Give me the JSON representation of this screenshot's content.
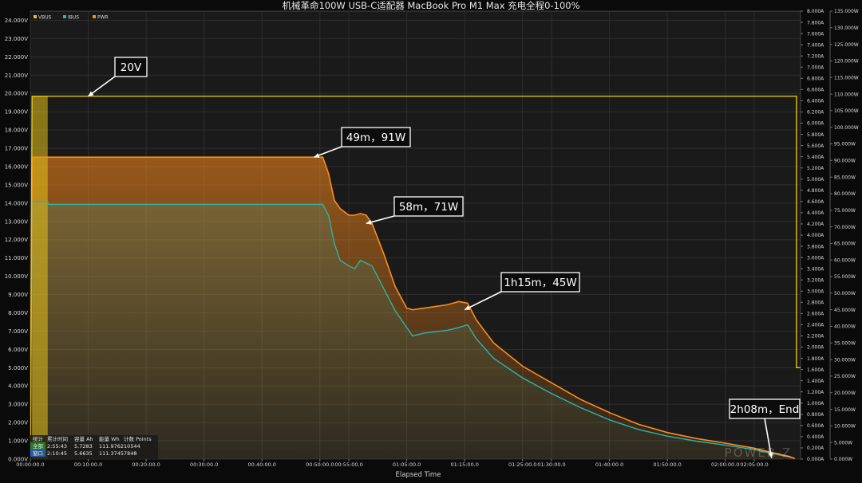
{
  "chart_data": {
    "type": "line",
    "title": "机械革命100W USB-C适配器 MacBook Pro M1 Max 充电全程0-100%",
    "xlabel": "Elapsed Time",
    "x_unit": "minutes",
    "xlim": [
      0,
      133
    ],
    "x_ticks": [
      {
        "t": 0,
        "label": "00:00:00.0"
      },
      {
        "t": 10,
        "label": "00:10:00.0"
      },
      {
        "t": 20,
        "label": "00:20:00.0"
      },
      {
        "t": 30,
        "label": "00:30:00.0"
      },
      {
        "t": 40,
        "label": "00:40:00.0"
      },
      {
        "t": 50,
        "label": "00:50:00.0"
      },
      {
        "t": 55,
        "label": "00:55:00.0"
      },
      {
        "t": 65,
        "label": "01:05:00.0"
      },
      {
        "t": 75,
        "label": "01:15:00.0"
      },
      {
        "t": 85,
        "label": "01:25:00.0"
      },
      {
        "t": 90,
        "label": "01:30:00.0"
      },
      {
        "t": 100,
        "label": "01:40:00.0"
      },
      {
        "t": 110,
        "label": "01:50:00.0"
      },
      {
        "t": 120,
        "label": "02:00:00.0"
      },
      {
        "t": 125,
        "label": "02:05:00.0"
      }
    ],
    "y_left": {
      "unit": "V",
      "min": 0,
      "max": 24.5,
      "step": 1,
      "decimals": 3
    },
    "y_right_current": {
      "unit": "A",
      "min": 0,
      "max": 8.0,
      "step": 0.2,
      "decimals": 3
    },
    "y_right_power": {
      "unit": "W",
      "min": 0,
      "max": 135,
      "step": 5,
      "decimals": 3
    },
    "grid": true,
    "legend_position": "top-left",
    "series": [
      {
        "name": "VBUS",
        "axis": "voltage",
        "color": "#e6c21a",
        "points": [
          [
            0,
            0
          ],
          [
            0.3,
            19.85
          ],
          [
            132.3,
            19.85
          ],
          [
            132.3,
            5.0
          ],
          [
            133,
            5.0
          ]
        ]
      },
      {
        "name": "IBUS",
        "axis": "current",
        "color": "#2ab5a8",
        "points": [
          [
            0,
            0
          ],
          [
            0.3,
            4.6
          ],
          [
            3.0,
            4.6
          ],
          [
            3.0,
            4.55
          ],
          [
            50.5,
            4.55
          ],
          [
            51.5,
            4.35
          ],
          [
            52.5,
            3.85
          ],
          [
            53.5,
            3.55
          ],
          [
            55,
            3.45
          ],
          [
            56,
            3.4
          ],
          [
            57,
            3.55
          ],
          [
            58,
            3.5
          ],
          [
            59,
            3.45
          ],
          [
            61,
            3.05
          ],
          [
            63,
            2.65
          ],
          [
            65,
            2.35
          ],
          [
            66,
            2.2
          ],
          [
            68,
            2.25
          ],
          [
            72,
            2.3
          ],
          [
            74,
            2.35
          ],
          [
            75.5,
            2.4
          ],
          [
            77,
            2.15
          ],
          [
            80,
            1.8
          ],
          [
            85,
            1.45
          ],
          [
            90,
            1.17
          ],
          [
            95,
            0.92
          ],
          [
            100,
            0.7
          ],
          [
            105,
            0.53
          ],
          [
            110,
            0.41
          ],
          [
            115,
            0.32
          ],
          [
            120,
            0.25
          ],
          [
            125,
            0.17
          ],
          [
            128,
            0.1
          ],
          [
            131,
            0.04
          ],
          [
            132,
            0.01
          ]
        ]
      },
      {
        "name": "PWR",
        "axis": "power",
        "color": "#ff8c1a",
        "points": [
          [
            0,
            0
          ],
          [
            0.3,
            91
          ],
          [
            3.0,
            91
          ],
          [
            50.5,
            91
          ],
          [
            51.5,
            86
          ],
          [
            52.5,
            78
          ],
          [
            53.5,
            75.5
          ],
          [
            55,
            73.5
          ],
          [
            56,
            73.5
          ],
          [
            57,
            74
          ],
          [
            58,
            73.5
          ],
          [
            59,
            71
          ],
          [
            61,
            62
          ],
          [
            63,
            52
          ],
          [
            65,
            45.5
          ],
          [
            66,
            45
          ],
          [
            68,
            45.5
          ],
          [
            72,
            46.5
          ],
          [
            74,
            47.5
          ],
          [
            75.5,
            47
          ],
          [
            77,
            42
          ],
          [
            80,
            35
          ],
          [
            85,
            28
          ],
          [
            90,
            23
          ],
          [
            95,
            18
          ],
          [
            100,
            14
          ],
          [
            105,
            10.5
          ],
          [
            110,
            8
          ],
          [
            115,
            6.2
          ],
          [
            120,
            4.8
          ],
          [
            125,
            3.3
          ],
          [
            128,
            2.0
          ],
          [
            131,
            0.8
          ],
          [
            132,
            0.2
          ]
        ]
      }
    ],
    "annotations": [
      {
        "text": "20V",
        "t": 10,
        "series": "VBUS",
        "value": 19.85
      },
      {
        "text": "49m，91W",
        "t": 49,
        "series": "PWR",
        "value": 91
      },
      {
        "text": "58m，71W",
        "t": 58,
        "series": "PWR",
        "value": 71
      },
      {
        "text": "1h15m，45W",
        "t": 75,
        "series": "PWR",
        "value": 45
      },
      {
        "text": "2h08m，End",
        "t": 128,
        "series": "PWR",
        "value": 0.3
      }
    ],
    "stats_table": {
      "headers": [
        "统计",
        "累计时间",
        "容量 Ah",
        "能量 Wh",
        "计数 Points"
      ],
      "rows": [
        [
          "全部",
          "2:55:43",
          "5.7283",
          "111.9762",
          "10544"
        ],
        [
          "窗口",
          "2:10:45",
          "5.6635",
          "111.3745",
          "7848"
        ]
      ]
    },
    "watermark": "POWER-Z"
  },
  "colors": {
    "background": "#0a0a0a",
    "plot_bg": "#1a1a1a",
    "grid": "#2e2e2e",
    "text": "#d8d8d8"
  }
}
